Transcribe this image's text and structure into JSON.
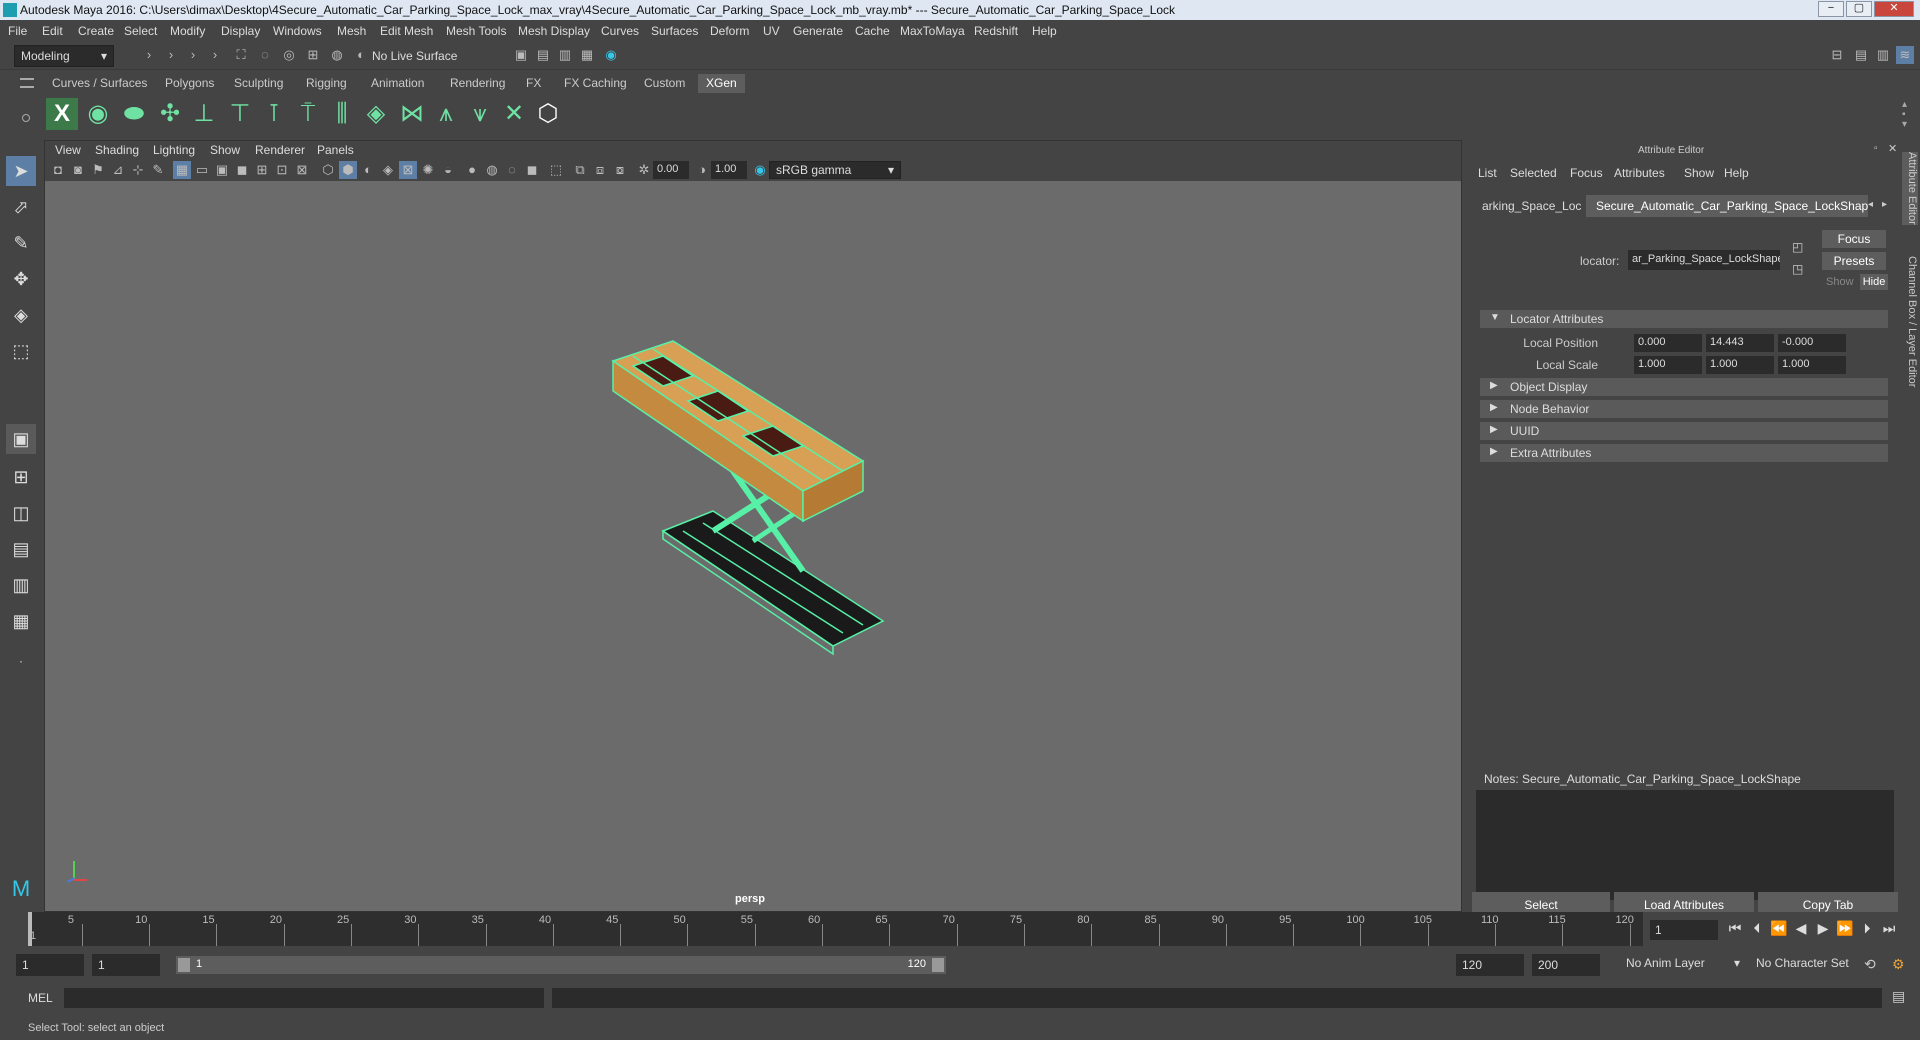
{
  "window": {
    "title": "Autodesk Maya 2016: C:\\Users\\dimax\\Desktop\\4Secure_Automatic_Car_Parking_Space_Lock_max_vray\\4Secure_Automatic_Car_Parking_Space_Lock_mb_vray.mb*   ---   Secure_Automatic_Car_Parking_Space_Lock",
    "minimize": "−",
    "maximize": "▢",
    "close": "✕"
  },
  "menubar": [
    "File",
    "Edit",
    "Create",
    "Select",
    "Modify",
    "Display",
    "Windows",
    "Mesh",
    "Edit Mesh",
    "Mesh Tools",
    "Mesh Display",
    "Curves",
    "Surfaces",
    "Deform",
    "UV",
    "Generate",
    "Cache",
    "MaxToMaya",
    "Redshift",
    "Help"
  ],
  "statusline": {
    "mode": "Modeling",
    "live_surface": "No Live Surface"
  },
  "shelf": {
    "tabs": [
      "Curves / Surfaces",
      "Polygons",
      "Sculpting",
      "Rigging",
      "Animation",
      "Rendering",
      "FX",
      "FX Caching",
      "Custom",
      "XGen"
    ],
    "active_tab": "XGen"
  },
  "viewport": {
    "menu": [
      "View",
      "Shading",
      "Lighting",
      "Show",
      "Renderer",
      "Panels"
    ],
    "exposure": "0.00",
    "gamma": "1.00",
    "color_space": "sRGB gamma",
    "camera": "persp"
  },
  "attribute_editor": {
    "title": "Attribute Editor",
    "menu": [
      "List",
      "Selected",
      "Focus",
      "Attributes",
      "Show",
      "Help"
    ],
    "tabs": [
      "arking_Space_Lock",
      "Secure_Automatic_Car_Parking_Space_LockShape"
    ],
    "locator_label": "locator:",
    "locator_value": "ar_Parking_Space_LockShape",
    "focus_btn": "Focus",
    "presets_btn": "Presets",
    "show_btn": "Show",
    "hide_btn": "Hide",
    "sections": {
      "locator": "Locator Attributes",
      "object_display": "Object Display",
      "node_behavior": "Node Behavior",
      "uuid": "UUID",
      "extra": "Extra Attributes"
    },
    "local_position": {
      "label": "Local Position",
      "x": "0.000",
      "y": "14.443",
      "z": "-0.000"
    },
    "local_scale": {
      "label": "Local Scale",
      "x": "1.000",
      "y": "1.000",
      "z": "1.000"
    },
    "notes_label": "Notes:  Secure_Automatic_Car_Parking_Space_LockShape",
    "select_btn": "Select",
    "load_btn": "Load Attributes",
    "copy_btn": "Copy Tab"
  },
  "side_tabs": {
    "attribute_editor": "Attribute Editor",
    "channel_box": "Channel Box / Layer Editor"
  },
  "timeline": {
    "ticks": [
      "5",
      "10",
      "15",
      "20",
      "25",
      "30",
      "35",
      "40",
      "45",
      "50",
      "55",
      "60",
      "65",
      "70",
      "75",
      "80",
      "85",
      "90",
      "95",
      "100",
      "105",
      "110",
      "115",
      "120"
    ],
    "start_marker": "1",
    "current_frame": "1"
  },
  "range": {
    "start": "1",
    "inner_start": "1",
    "slider_start": "1",
    "slider_end": "120",
    "inner_end": "120",
    "end": "200",
    "anim_layer": "No Anim Layer",
    "char_set": "No Character Set"
  },
  "cmdline": {
    "label": "MEL"
  },
  "helpline": {
    "text": "Select Tool: select an object"
  },
  "colors": {
    "accent": "#6fe2a3",
    "wire": "#57f0a6",
    "panel": "#444444"
  }
}
